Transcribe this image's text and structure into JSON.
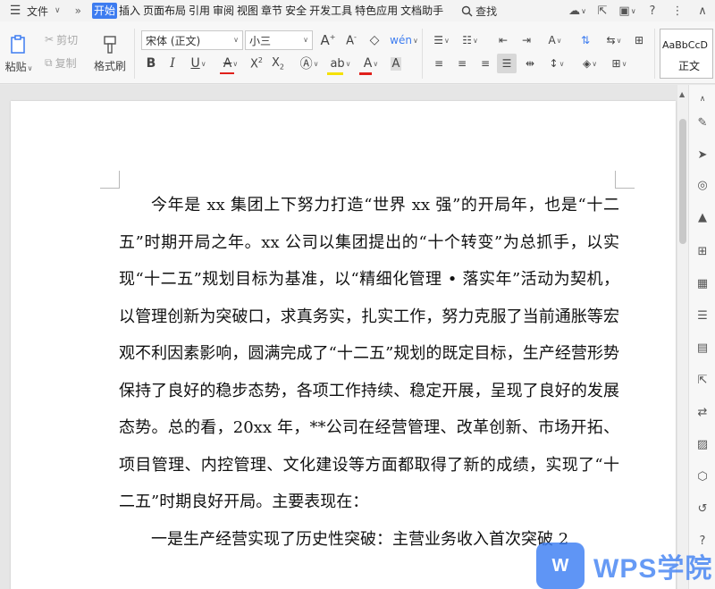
{
  "menubar": {
    "file_label": "文件",
    "more_label": "»",
    "tabs": [
      "开始",
      "插入",
      "页面布局",
      "引用",
      "审阅",
      "视图",
      "章节",
      "安全",
      "开发工具",
      "特色应用",
      "文档助手"
    ],
    "active_tab": "开始",
    "search_label": "查找"
  },
  "ribbon": {
    "paste_label": "粘贴",
    "cut_label": "剪切",
    "copy_label": "复制",
    "format_painter_label": "格式刷",
    "font_name": "宋体 (正文)",
    "font_size": "小三",
    "style_preview": "AaBbCcD",
    "style_name": "正文"
  },
  "colors": {
    "accent": "#3d7cf0",
    "highlight": "#f5e100",
    "font_color": "#e0201b",
    "strike_color": "#e0201b"
  },
  "document": {
    "paragraphs": [
      "今年是 xx 集团上下努力打造“世界 xx 强”的开局年，也是“十二五”时期开局之年。xx 公司以集团提出的“十个转变”为总抓手，以实现“十二五”规划目标为基准，以“精细化管理 • 落实年”活动为契机，以管理创新为突破口，求真务实，扎实工作，努力克服了当前通胀等宏观不利因素影响，圆满完成了“十二五”规划的既定目标，生产经营形势保持了良好的稳步态势，各项工作持续、稳定开展，呈现了良好的发展态势。总的看，20xx 年，**公司在经营管理、改革创新、市场开拓、项目管理、内控管理、文化建设等方面都取得了新的成绩，实现了“十二五”时期良好开局。主要表现在：",
      "一是生产经营实现了历史性突破：主营业务收入首次突破 2"
    ]
  },
  "watermark": {
    "logo_text": "W",
    "brand_text": "WPS学院"
  }
}
